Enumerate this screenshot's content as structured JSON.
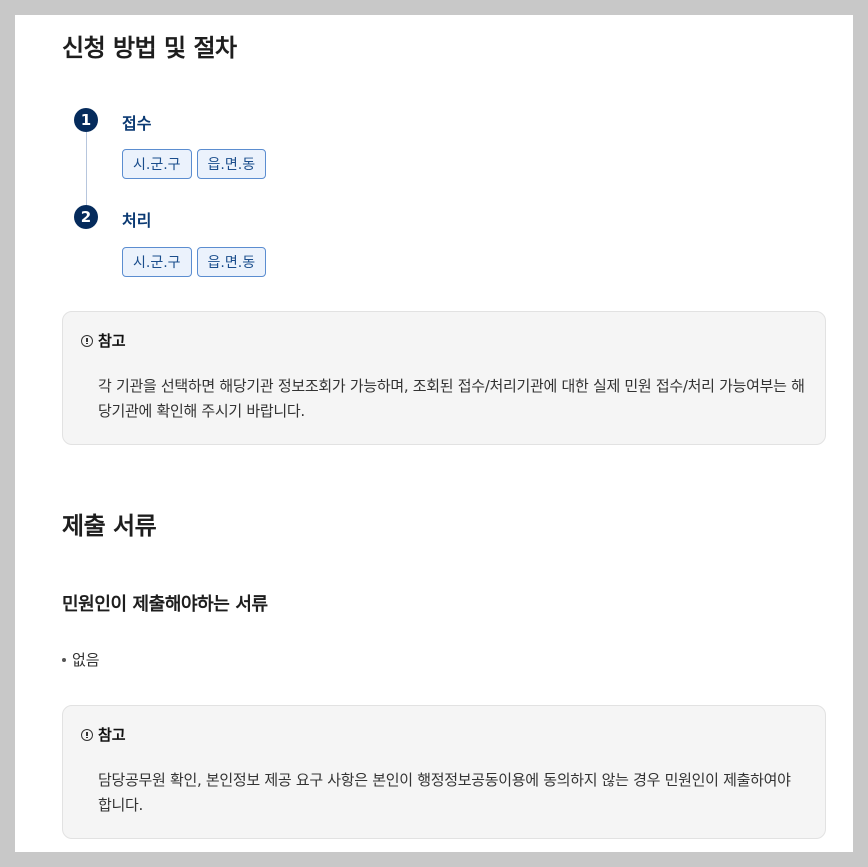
{
  "procedure": {
    "title": "신청 방법 및 절차",
    "steps": [
      {
        "num": "1",
        "label": "접수",
        "chips": [
          "시.군.구",
          "읍.면.동"
        ]
      },
      {
        "num": "2",
        "label": "처리",
        "chips": [
          "시.군.구",
          "읍.면.동"
        ]
      }
    ],
    "note": {
      "title": "참고",
      "body": "각 기관을 선택하면 해당기관 정보조회가 가능하며, 조회된 접수/처리기관에 대한 실제 민원 접수/처리 가능여부는 해당기관에 확인해 주시기 바랍니다."
    }
  },
  "documents": {
    "title": "제출 서류",
    "subtitle": "민원인이 제출해야하는 서류",
    "items": [
      "없음"
    ],
    "note": {
      "title": "참고",
      "body": "담당공무원 확인, 본인정보 제공 요구 사항은 본인이 행정정보공동이용에 동의하지 않는 경우 민원인이 제출하여야 합니다."
    }
  },
  "colors": {
    "step_badge": "#052b5c",
    "chip_border": "#5b8dd0",
    "chip_bg": "#ebf2fc",
    "note_bg": "#f5f5f5"
  },
  "icons": {
    "note": "info-circle-icon"
  }
}
